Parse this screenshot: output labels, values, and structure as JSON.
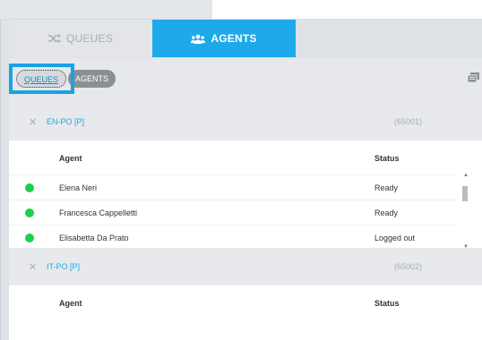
{
  "main_tabs": {
    "queues_label": "QUEUES",
    "agents_label": "AGENTS"
  },
  "sub_toggle": {
    "queues_label": "QUEUES",
    "agents_label": "AGENTS"
  },
  "table_columns": {
    "agent": "Agent",
    "status": "Status"
  },
  "queues": [
    {
      "name": "EN-PO [P]",
      "number": "(65001)",
      "agents": [
        {
          "name": "Elena Neri",
          "status": "Ready",
          "indicator": "#1ecf4f"
        },
        {
          "name": "Francesca Cappelletti",
          "status": "Ready",
          "indicator": "#1ecf4f"
        },
        {
          "name": "Elisabetta Da Prato",
          "status": "Logged out",
          "indicator": "#1ecf4f"
        }
      ]
    },
    {
      "name": "IT-PO [P]",
      "number": "(65002)",
      "agents": []
    }
  ],
  "colors": {
    "accent": "#1da9ea",
    "ready": "#1ecf4f"
  }
}
